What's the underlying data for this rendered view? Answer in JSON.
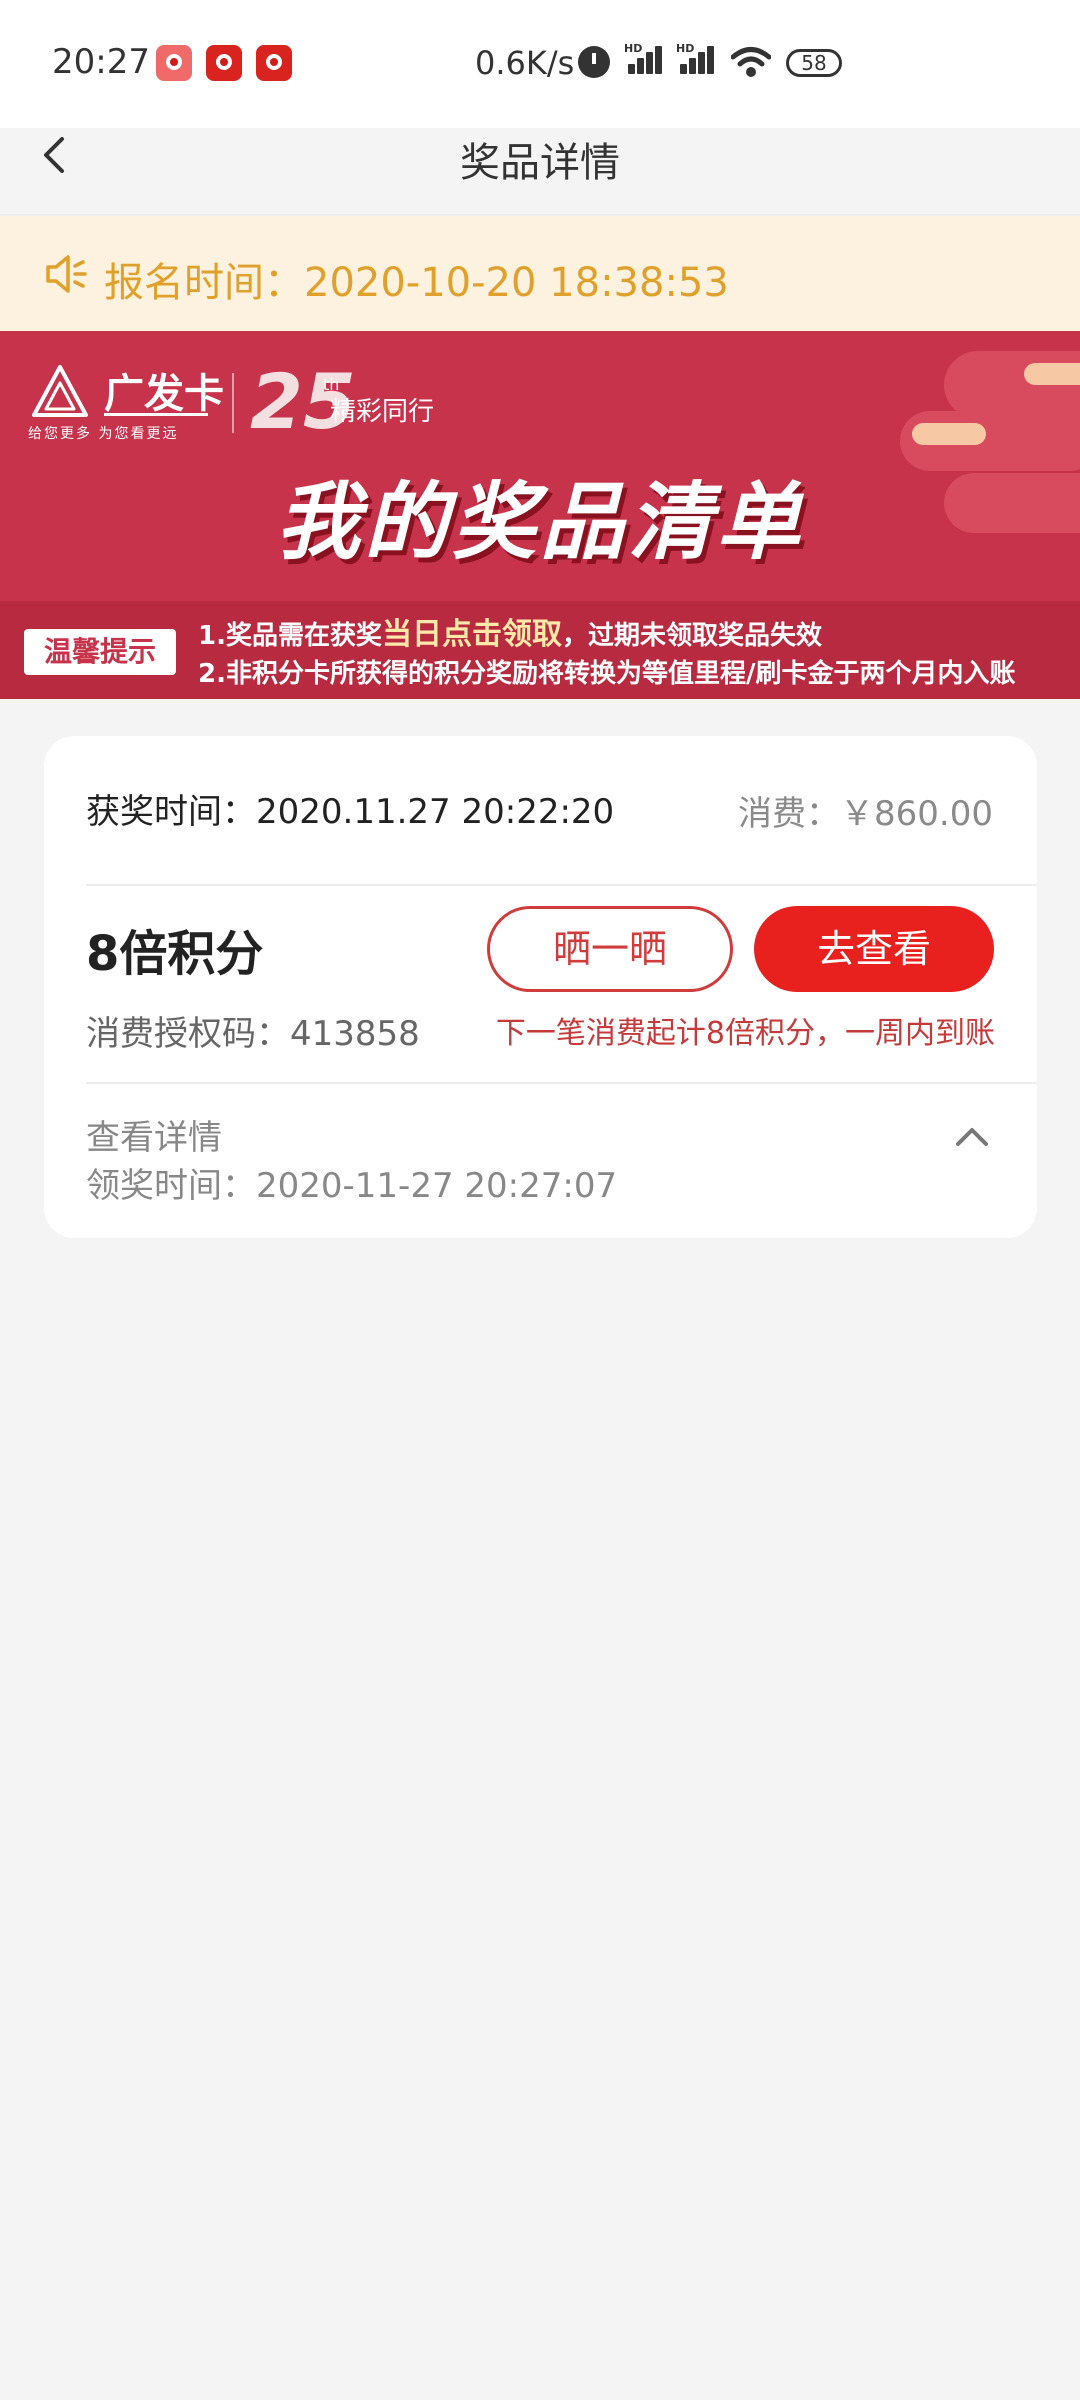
{
  "status_bar": {
    "time": "20:27",
    "net_speed": "0.6K/s",
    "signal_label": "HD",
    "battery": "58"
  },
  "nav": {
    "title": "奖品详情"
  },
  "notice": {
    "text": "报名时间：2020-10-20 18:38:53"
  },
  "banner": {
    "brand_name": "广发卡",
    "brand_slogan": "给您更多 为您看更远",
    "anniversary_number": "25",
    "anniversary_suffix": "th",
    "anniversary_text": "精彩同行",
    "title": "我的奖品清单",
    "tips_badge": "温馨提示",
    "tip1_prefix": "1.奖品需在获奖",
    "tip1_highlight": "当日点击领取",
    "tip1_suffix": "，过期未领取奖品失效",
    "tip2": "2.非积分卡所获得的积分奖励将转换为等值里程/刷卡金于两个月内入账"
  },
  "card": {
    "award_time": "获奖时间：2020.11.27 20:22:20",
    "spend": "消费：￥860.00",
    "prize_name": "8倍积分",
    "auth_code": "消费授权码：413858",
    "share_button": "晒一晒",
    "view_button": "去查看",
    "points_note": "下一笔消费起计8倍积分，一周内到账",
    "details_label": "查看详情",
    "claim_time": "领奖时间：2020-11-27 20:27:07"
  },
  "colors": {
    "accent_red": "#e8211e",
    "banner_red": "#c7334a",
    "notice_bg": "#fdf1df",
    "notice_text": "#e0a12c"
  }
}
